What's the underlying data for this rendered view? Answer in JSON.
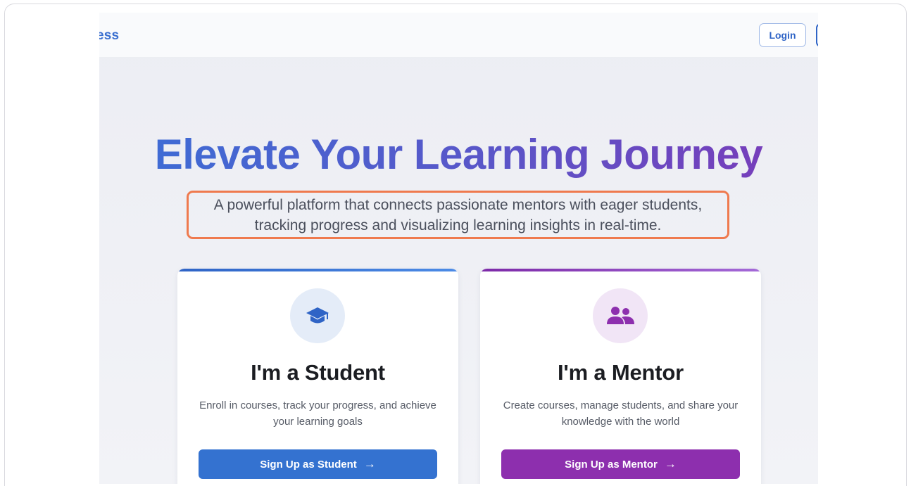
{
  "header": {
    "brand_fragment": "ess",
    "login_label": "Login"
  },
  "hero": {
    "title": "Elevate Your Learning Journey",
    "subtitle": "A powerful platform that connects passionate mentors with eager students, tracking progress and visualizing learning insights in real-time."
  },
  "cards": {
    "student": {
      "icon": "graduation-cap-icon",
      "title": "I'm a Student",
      "description": "Enroll in courses, track your progress, and achieve your learning goals",
      "button_label": "Sign Up as Student",
      "accent": "#3472d0"
    },
    "mentor": {
      "icon": "users-icon",
      "title": "I'm a Mentor",
      "description": "Create courses, manage students, and share your knowledge with the world",
      "button_label": "Sign Up as Mentor",
      "accent": "#8d2fae"
    }
  },
  "colors": {
    "highlight_border": "#ef7a4e",
    "title_gradient_start": "#3b6fd6",
    "title_gradient_end": "#7c3ab8"
  }
}
